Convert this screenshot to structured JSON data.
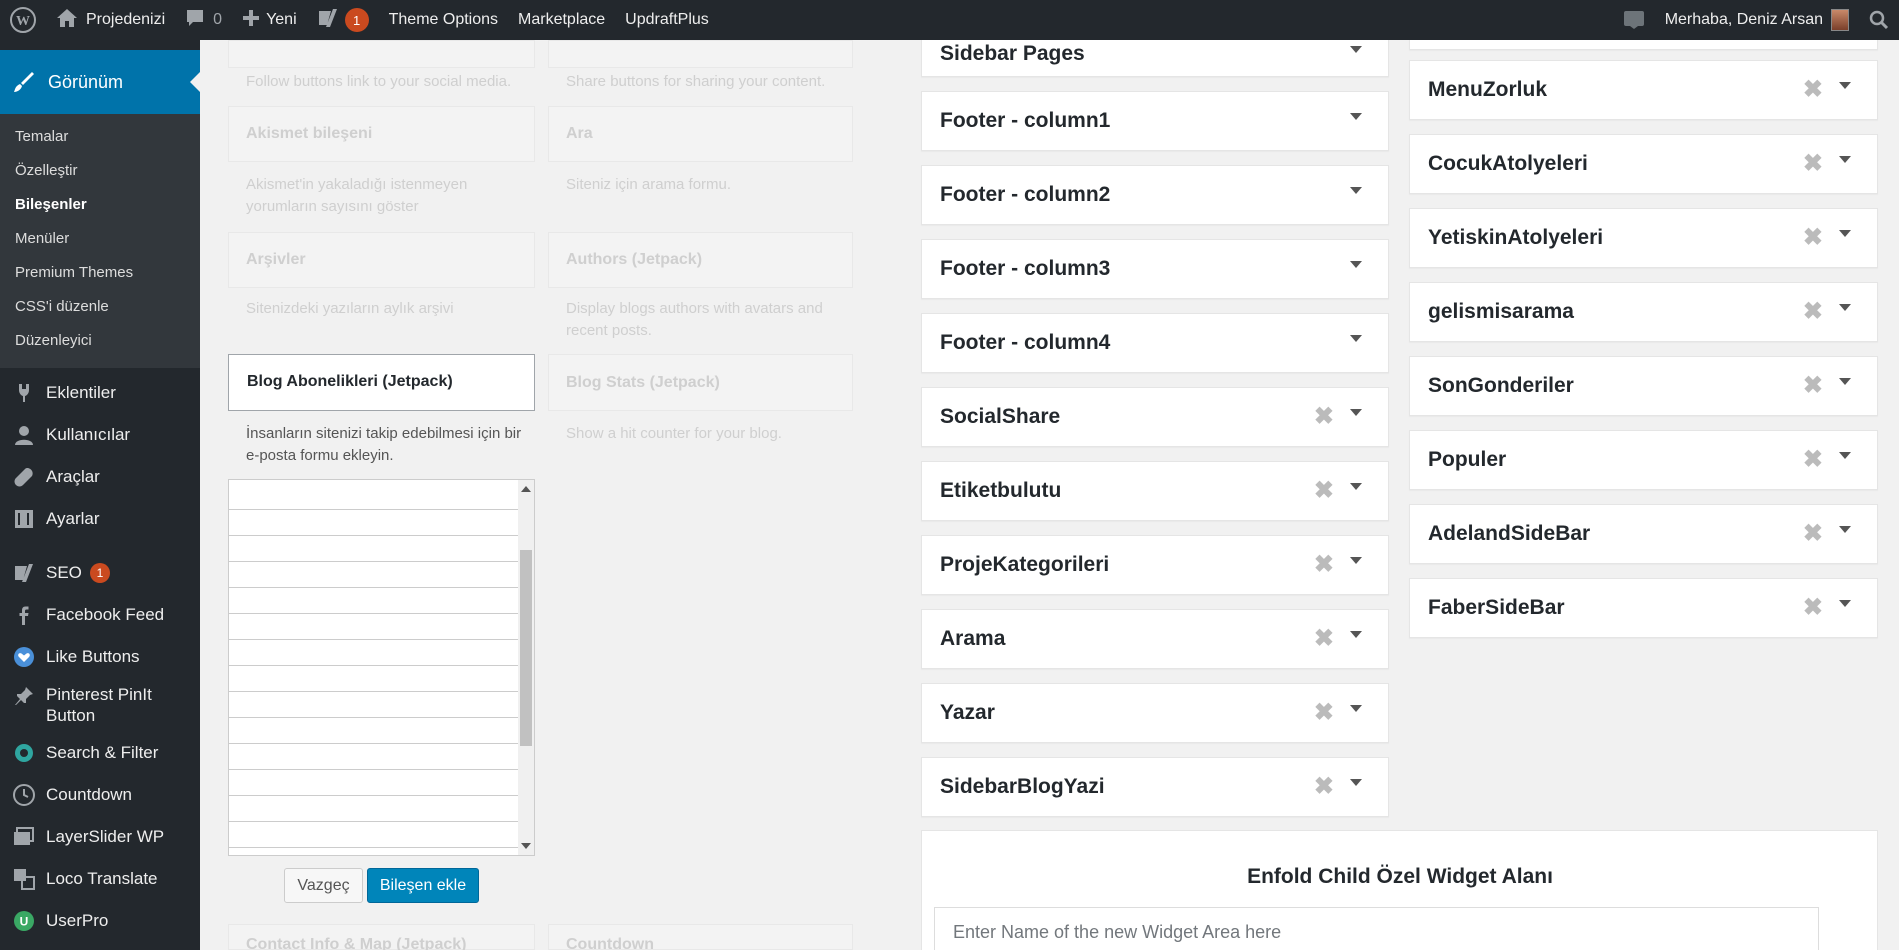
{
  "adminbar": {
    "site_name": "Projedenizi",
    "comments_count": "0",
    "new_label": "Yeni",
    "yoast_badge": "1",
    "theme_options": "Theme Options",
    "marketplace": "Marketplace",
    "updraftplus": "UpdraftPlus",
    "greeting": "Merhaba, Deniz Arsan"
  },
  "sidebar": {
    "active": "Görünüm",
    "submenu": [
      "Temalar",
      "Özelleştir",
      "Bileşenler",
      "Menüler",
      "Premium Themes",
      "CSS'i düzenle",
      "Düzenleyici"
    ],
    "items": {
      "eklentiler": "Eklentiler",
      "kullanicilar": "Kullanıcılar",
      "araclar": "Araçlar",
      "ayarlar": "Ayarlar",
      "seo": "SEO",
      "seo_badge": "1",
      "facebook_feed": "Facebook Feed",
      "like_buttons": "Like Buttons",
      "pinterest_line1": "Pinterest PinIt",
      "pinterest_line2": "Button",
      "search_filter": "Search & Filter",
      "countdown": "Countdown",
      "layerslider": "LayerSlider WP",
      "loco": "Loco Translate",
      "userpro": "UserPro"
    }
  },
  "available": {
    "follow_desc": "Follow buttons link to your social media.",
    "share_desc": "Share buttons for sharing your content.",
    "akismet_title": "Akismet bileşeni",
    "akismet_desc": "Akismet'in yakaladığı istenmeyen yorumların sayısını göster",
    "ara_title": "Ara",
    "ara_desc": "Siteniz için arama formu.",
    "arsivler_title": "Arşivler",
    "arsivler_desc": "Sitenizdeki yazıların aylık arşivi",
    "authors_title": "Authors (Jetpack)",
    "authors_desc": "Display blogs authors with avatars and recent posts.",
    "blogstats_title": "Blog Stats (Jetpack)",
    "blogstats_desc": "Show a hit counter for your blog.",
    "contact_title": "Contact Info & Map (Jetpack)",
    "countdown_title": "Countdown"
  },
  "selected_widget": {
    "title": "Blog Abonelikleri (Jetpack)",
    "description": "İnsanların sitenizi takip edebilmesi için bir e-posta formu ekleyin.",
    "cancel": "Vazgeç",
    "add": "Bileşen ekle"
  },
  "areas_left": [
    "Sidebar Pages",
    "Footer - column1",
    "Footer - column2",
    "Footer - column3",
    "Footer - column4",
    "SocialShare",
    "Etiketbulutu",
    "ProjeKategorileri",
    "Arama",
    "Yazar",
    "SidebarBlogYazi"
  ],
  "areas_right": [
    "MenuZorluk",
    "CocukAtolyeleri",
    "YetiskinAtolyeleri",
    "gelismisarama",
    "SonGonderiler",
    "Populer",
    "AdelandSideBar",
    "FaberSideBar"
  ],
  "custom_area": {
    "title": "Enfold Child Özel Widget Alanı",
    "placeholder": "Enter Name of the new Widget Area here"
  }
}
